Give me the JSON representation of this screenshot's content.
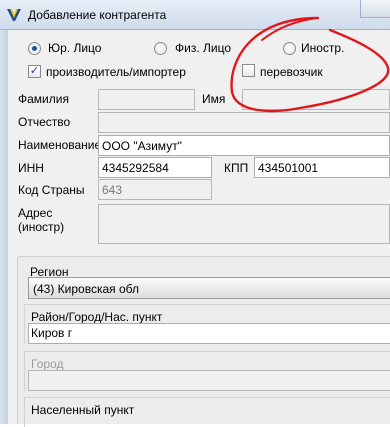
{
  "window": {
    "title": "Добавление контрагента",
    "app_icon": "app-icon",
    "close_icon": "close-icon"
  },
  "type_options": {
    "legal": "Юр. Лицо",
    "individual": "Физ. Лицо",
    "foreign": "Иностр.",
    "selected": "legal"
  },
  "flags": {
    "manufacturer_label": "производитель/импортер",
    "manufacturer_checked": true,
    "carrier_label": "перевозчик",
    "carrier_checked": false
  },
  "fields": {
    "surname_label": "Фамилия",
    "surname_value": "",
    "name_label": "Имя",
    "name_value": "",
    "patronymic_label": "Отчество",
    "patronymic_value": "",
    "org_name_label": "Наименование",
    "org_name_value": "ООО \"Азимут\"",
    "inn_label": "ИНН",
    "inn_value": "4345292584",
    "kpp_label": "КПП",
    "kpp_value": "434501001",
    "country_code_label": "Код Страны",
    "country_code_value": "643",
    "address_label": "Адрес\n(иностр)",
    "address_value": ""
  },
  "address_group": {
    "region_label": "Регион",
    "region_value": "(43) Кировская обл",
    "district_label": "Район/Город/Нас. пункт",
    "district_value": "Киров г",
    "city_label": "Город",
    "city_value": "",
    "settlement_label": "Населенный пункт",
    "settlement_value": ""
  },
  "colors": {
    "annotation_stroke": "#e0181b",
    "radio_dot": "#1c4f9c"
  }
}
